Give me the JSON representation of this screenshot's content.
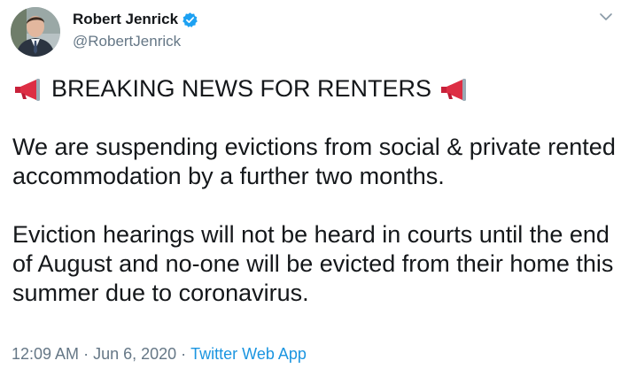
{
  "author": {
    "display_name": "Robert Jenrick",
    "handle": "@RobertJenrick",
    "verified": true,
    "avatar_icon": "profile-photo"
  },
  "tweet": {
    "headline": "BREAKING NEWS FOR RENTERS",
    "headline_icon": "loudspeaker-icon",
    "paragraph_1": "We are suspending evictions from social & private rented accommodation by a further two months.",
    "paragraph_2": "Eviction hearings will not be heard in courts until the end of August and no-one will be evicted from their home this summer due to coronavirus."
  },
  "meta": {
    "time": "12:09 AM",
    "date": "Jun 6, 2020",
    "source_app": "Twitter Web App",
    "separator": "·"
  },
  "colors": {
    "text": "#14171a",
    "secondary": "#657786",
    "link": "#1b95e0",
    "verified_badge": "#1da1f2"
  }
}
